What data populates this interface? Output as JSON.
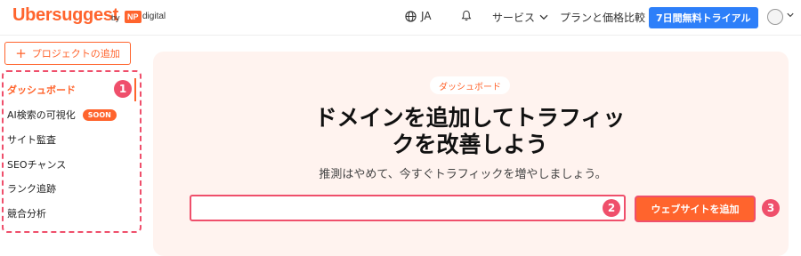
{
  "brand": {
    "name": "Ubersuggest",
    "by": "by",
    "np": "NP",
    "digital": "digital"
  },
  "header": {
    "language": "JA",
    "services": "サービス",
    "pricing": "プランと価格比較",
    "trial_button": "7日間無料トライアル"
  },
  "sidebar": {
    "add_project": "プロジェクトの追加",
    "items": [
      {
        "label": "ダッシュボード",
        "active": true
      },
      {
        "label": "AI検索の可視化",
        "badge": "SOON"
      },
      {
        "label": "サイト監査"
      },
      {
        "label": "SEOチャンス"
      },
      {
        "label": "ランク追跡"
      },
      {
        "label": "競合分析"
      }
    ]
  },
  "main": {
    "pill": "ダッシュボード",
    "headline_line1": "ドメインを追加してトラフィッ",
    "headline_line2": "クを改善しよう",
    "subline": "推測はやめて、今すぐトラフィックを増やしましょう。",
    "input_value": "",
    "input_placeholder": "",
    "add_button": "ウェブサイトを追加"
  },
  "annotations": {
    "badge1": "1",
    "badge2": "2",
    "badge3": "3"
  },
  "colors": {
    "brand": "#ff642d",
    "trial": "#2d7ff9",
    "annotation": "#ef4f6b",
    "panel": "#fff3ef"
  }
}
